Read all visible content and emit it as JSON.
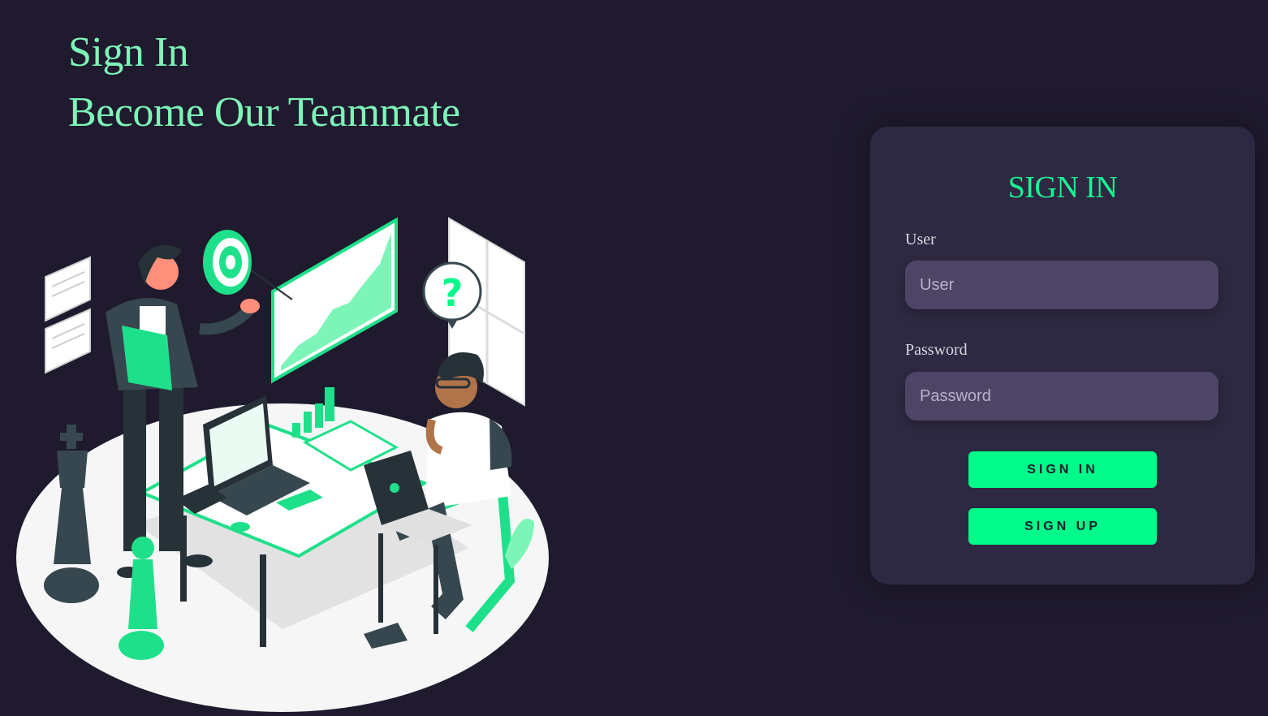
{
  "hero": {
    "line1": "Sign In",
    "line2": "Become Our Teammate"
  },
  "illustration": {
    "icon": "team-meeting-illustration",
    "question_mark": "?"
  },
  "form": {
    "title": "SIGN IN",
    "user_label": "User",
    "user_placeholder": "User",
    "password_label": "Password",
    "password_placeholder": "Password",
    "signin_label": "SIGN IN",
    "signup_label": "SIGN UP"
  },
  "colors": {
    "background": "#1f1a2e",
    "card": "#2e2942",
    "accent": "#02fa8a",
    "headline": "#7ef5b8",
    "input": "#4e4566"
  }
}
